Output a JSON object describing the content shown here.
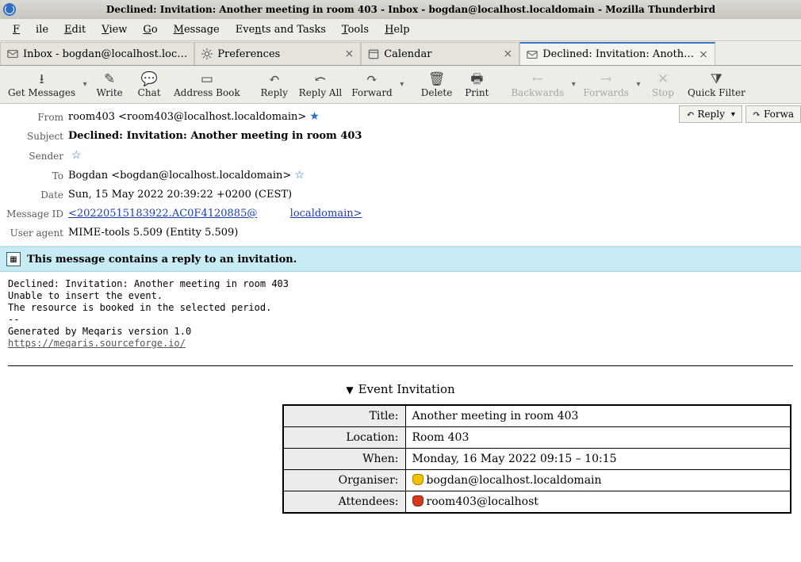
{
  "title": "Declined: Invitation: Another meeting in room 403 - Inbox - bogdan@localhost.localdomain - Mozilla Thunderbird",
  "menu": {
    "file": "File",
    "edit": "Edit",
    "view": "View",
    "go": "Go",
    "message": "Message",
    "events": "Events and Tasks",
    "tools": "Tools",
    "help": "Help"
  },
  "tabs": [
    {
      "label": "Inbox - bogdan@localhost.loc…",
      "closable": false
    },
    {
      "label": "Preferences",
      "closable": true
    },
    {
      "label": "Calendar",
      "closable": true
    },
    {
      "label": "Declined: Invitation: Anoth…",
      "closable": true,
      "active": true
    }
  ],
  "toolbar": {
    "get": "Get Messages",
    "write": "Write",
    "chat": "Chat",
    "abook": "Address Book",
    "reply": "Reply",
    "replyall": "Reply All",
    "forward": "Forward",
    "delete": "Delete",
    "print": "Print",
    "back": "Backwards",
    "fwd": "Forwards",
    "stop": "Stop",
    "qfilter": "Quick Filter"
  },
  "headers": {
    "from_label": "From",
    "from": "room403 <room403@localhost.localdomain>",
    "subject_label": "Subject",
    "subject": "Declined: Invitation: Another meeting in room 403",
    "sender_label": "Sender",
    "sender": "",
    "to_label": "To",
    "to": "Bogdan <bogdan@localhost.localdomain>",
    "date_label": "Date",
    "date": "Sun, 15 May 2022 20:39:22 +0200 (CEST)",
    "msgid_label": "Message ID",
    "msgid_a": "<20220515183922.AC0F4120885@",
    "msgid_b": "localdomain>",
    "ua_label": "User agent",
    "ua": "MIME-tools 5.509 (Entity 5.509)"
  },
  "action_buttons": {
    "reply": "Reply",
    "forward": "Forwa"
  },
  "invite_bar": "This message contains a reply to an invitation.",
  "body": {
    "l1": "Declined: Invitation: Another meeting in room 403",
    "l2": "Unable to insert the event.",
    "l3": "The resource is booked in the selected period.",
    "l4": "--",
    "l5": "Generated by Meqaris version 1.0",
    "link": "https://meqaris.sourceforge.io/"
  },
  "event": {
    "heading": "Event Invitation",
    "title_label": "Title:",
    "title": "Another meeting in room 403",
    "loc_label": "Location:",
    "loc": "Room 403",
    "when_label": "When:",
    "when": "Monday, 16 May 2022 09:15 – 10:15",
    "org_label": "Organiser:",
    "org": "bogdan@localhost.localdomain",
    "att_label": "Attendees:",
    "att": "room403@localhost"
  }
}
